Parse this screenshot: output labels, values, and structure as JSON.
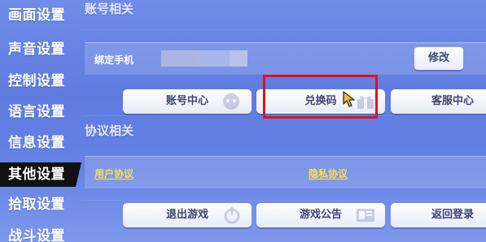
{
  "sidebar": {
    "items": [
      {
        "label": "画面设置"
      },
      {
        "label": "声音设置"
      },
      {
        "label": "控制设置"
      },
      {
        "label": "语言设置"
      },
      {
        "label": "信息设置"
      },
      {
        "label": "其他设置"
      },
      {
        "label": "拾取设置"
      },
      {
        "label": "战斗设置"
      }
    ],
    "active_index": 5
  },
  "account": {
    "title": "账号相关",
    "bind_phone_label": "绑定手机",
    "modify_label": "修改",
    "buttons": {
      "account_center": "账号中心",
      "redeem_code": "兑换码",
      "customer_service": "客服中心"
    }
  },
  "protocol": {
    "title": "协议相关",
    "user_agreement": "用户协议",
    "privacy_policy": "隐私协议",
    "buttons": {
      "exit_game": "退出游戏",
      "game_notice": "游戏公告",
      "back_to_login": "返回登录"
    }
  },
  "colors": {
    "highlight": "#e3101c",
    "link": "#ffe14a",
    "active_nav": "#111111"
  },
  "icons": {
    "cursor": "mouse-cursor-icon",
    "power": "power-icon",
    "notice": "notice-icon",
    "mascot": "mascot-icon",
    "gift": "gift-icon"
  }
}
